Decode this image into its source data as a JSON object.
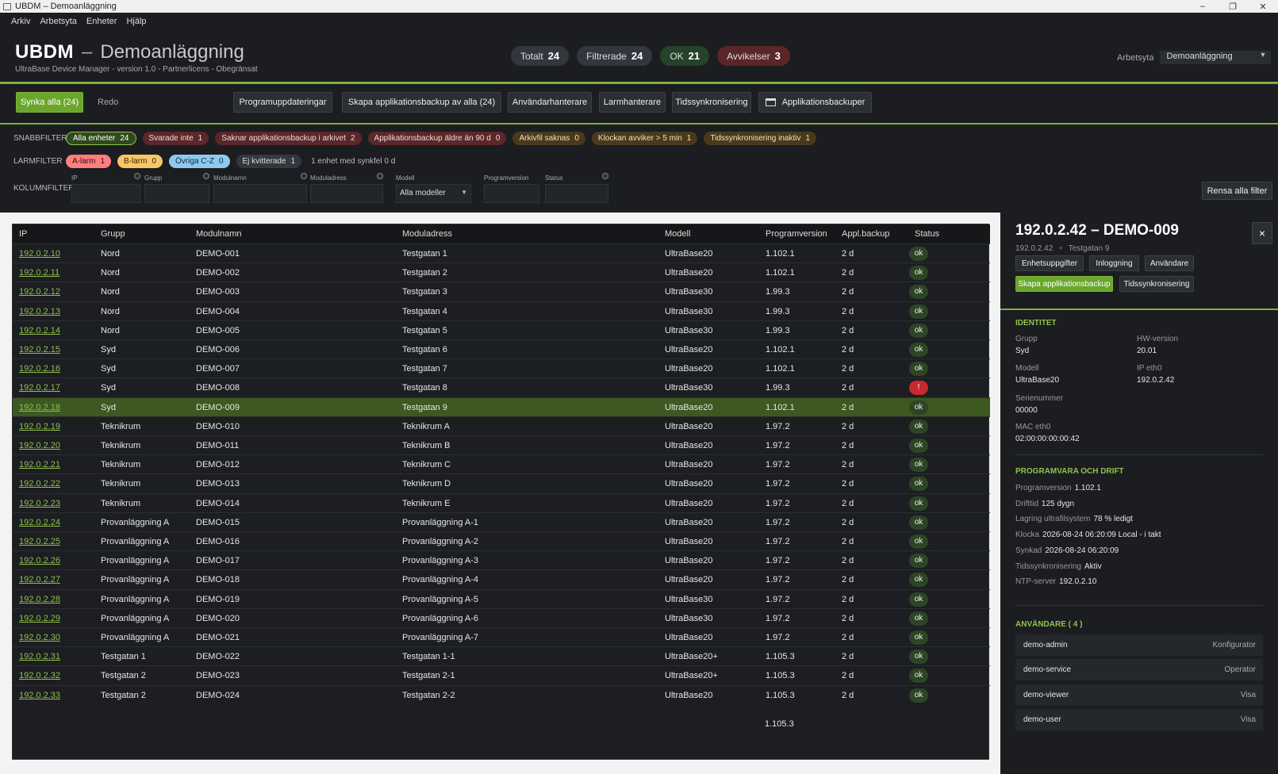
{
  "window": {
    "title": "UBDM – Demoanläggning",
    "controls": [
      "–",
      "❐",
      "✕"
    ]
  },
  "menu": [
    "Arkiv",
    "Arbetsyta",
    "Enheter",
    "Hjälp"
  ],
  "header": {
    "app": "UBDM",
    "dash": "–",
    "plant": "Demoanläggning",
    "subtitle": "UltraBase Device Manager - version 1.0 - Partnerlicens - Obegränsat",
    "counters": [
      {
        "label": "Totalt",
        "value": "24"
      },
      {
        "label": "Filtrerade",
        "value": "24"
      },
      {
        "label": "OK",
        "value": "21"
      },
      {
        "label": "Avvikelser",
        "value": "3"
      }
    ],
    "workspace_label": "Arbetsyta",
    "workspace_value": "Demoanläggning"
  },
  "toolbar": {
    "sync_all": "Synka alla (24)",
    "redo": "Redo",
    "buttons": [
      "Programuppdateringar",
      "Skapa applikationsbackup av alla (24)",
      "Användarhanterare",
      "Larmhanterare",
      "Tidssynkronisering",
      "Applikationsbackuper"
    ]
  },
  "quickfilter": {
    "label": "SNABBFILTER",
    "chips": [
      {
        "label": "Alla enheter",
        "count": "24"
      },
      {
        "label": "Svarade inte",
        "count": "1"
      },
      {
        "label": "Saknar applikationsbackup i arkivet",
        "count": "2"
      },
      {
        "label": "Applikationsbackup äldre än 90 d",
        "count": "0"
      },
      {
        "label": "Arkivfil saknas",
        "count": "0"
      },
      {
        "label": "Klockan avviker > 5 min",
        "count": "1"
      },
      {
        "label": "Tidssynkronisering inaktiv",
        "count": "1"
      }
    ]
  },
  "alarmfilter": {
    "label": "LARMFILTER",
    "chips": [
      {
        "label": "A-larm",
        "count": "1"
      },
      {
        "label": "B-larm",
        "count": "0"
      },
      {
        "label": "Övriga C-Z",
        "count": "0"
      },
      {
        "label": "Ej kvitterade",
        "count": "1"
      }
    ],
    "note": "1 enhet med synkfel 0 d"
  },
  "columnfilter": {
    "label": "KOLUMNFILTER",
    "fields": [
      "IP",
      "Grupp",
      "Modulnamn",
      "Moduladress",
      "Modell",
      "Programversion",
      "Status"
    ],
    "model_select": "Alla modeller",
    "clear": "Rensa alla filter"
  },
  "table": {
    "headers": [
      "IP",
      "Grupp",
      "Modulnamn",
      "Moduladress",
      "Modell",
      "Programversion",
      "Appl.backup",
      "Status"
    ],
    "rows": [
      [
        "192.0.2.10",
        "Nord",
        "DEMO-001",
        "Testgatan 1",
        "UltraBase20",
        "1.102.1",
        "2 d",
        "ok"
      ],
      [
        "192.0.2.11",
        "Nord",
        "DEMO-002",
        "Testgatan 2",
        "UltraBase20",
        "1.102.1",
        "2 d",
        "ok"
      ],
      [
        "192.0.2.12",
        "Nord",
        "DEMO-003",
        "Testgatan 3",
        "UltraBase30",
        "1.99.3",
        "2 d",
        "ok"
      ],
      [
        "192.0.2.13",
        "Nord",
        "DEMO-004",
        "Testgatan 4",
        "UltraBase30",
        "1.99.3",
        "2 d",
        "ok"
      ],
      [
        "192.0.2.14",
        "Nord",
        "DEMO-005",
        "Testgatan 5",
        "UltraBase30",
        "1.99.3",
        "2 d",
        "ok"
      ],
      [
        "192.0.2.15",
        "Syd",
        "DEMO-006",
        "Testgatan 6",
        "UltraBase20",
        "1.102.1",
        "2 d",
        "ok"
      ],
      [
        "192.0.2.16",
        "Syd",
        "DEMO-007",
        "Testgatan 7",
        "UltraBase20",
        "1.102.1",
        "2 d",
        "ok"
      ],
      [
        "192.0.2.17",
        "Syd",
        "DEMO-008",
        "Testgatan 8",
        "UltraBase30",
        "1.99.3",
        "2 d",
        "!"
      ],
      [
        "192.0.2.18",
        "Syd",
        "DEMO-009",
        "Testgatan 9",
        "UltraBase20",
        "1.102.1",
        "2 d",
        "ok"
      ],
      [
        "192.0.2.19",
        "Teknikrum",
        "DEMO-010",
        "Teknikrum A",
        "UltraBase20",
        "1.97.2",
        "2 d",
        "ok"
      ],
      [
        "192.0.2.20",
        "Teknikrum",
        "DEMO-011",
        "Teknikrum B",
        "UltraBase20",
        "1.97.2",
        "2 d",
        "ok"
      ],
      [
        "192.0.2.21",
        "Teknikrum",
        "DEMO-012",
        "Teknikrum C",
        "UltraBase20",
        "1.97.2",
        "2 d",
        "ok"
      ],
      [
        "192.0.2.22",
        "Teknikrum",
        "DEMO-013",
        "Teknikrum D",
        "UltraBase20",
        "1.97.2",
        "2 d",
        "ok"
      ],
      [
        "192.0.2.23",
        "Teknikrum",
        "DEMO-014",
        "Teknikrum E",
        "UltraBase20",
        "1.97.2",
        "2 d",
        "ok"
      ],
      [
        "192.0.2.24",
        "Provanläggning A",
        "DEMO-015",
        "Provanläggning A-1",
        "UltraBase20",
        "1.97.2",
        "2 d",
        "ok"
      ],
      [
        "192.0.2.25",
        "Provanläggning A",
        "DEMO-016",
        "Provanläggning A-2",
        "UltraBase20",
        "1.97.2",
        "2 d",
        "ok"
      ],
      [
        "192.0.2.26",
        "Provanläggning A",
        "DEMO-017",
        "Provanläggning A-3",
        "UltraBase20",
        "1.97.2",
        "2 d",
        "ok"
      ],
      [
        "192.0.2.27",
        "Provanläggning A",
        "DEMO-018",
        "Provanläggning A-4",
        "UltraBase20",
        "1.97.2",
        "2 d",
        "ok"
      ],
      [
        "192.0.2.28",
        "Provanläggning A",
        "DEMO-019",
        "Provanläggning A-5",
        "UltraBase30",
        "1.97.2",
        "2 d",
        "ok"
      ],
      [
        "192.0.2.29",
        "Provanläggning A",
        "DEMO-020",
        "Provanläggning A-6",
        "UltraBase30",
        "1.97.2",
        "2 d",
        "ok"
      ],
      [
        "192.0.2.30",
        "Provanläggning A",
        "DEMO-021",
        "Provanläggning A-7",
        "UltraBase20",
        "1.97.2",
        "2 d",
        "ok"
      ],
      [
        "192.0.2.31",
        "Testgatan 1",
        "DEMO-022",
        "Testgatan 1-1",
        "UltraBase20+",
        "1.105.3",
        "2 d",
        "ok"
      ],
      [
        "192.0.2.32",
        "Testgatan 2",
        "DEMO-023",
        "Testgatan 2-1",
        "UltraBase20+",
        "1.105.3",
        "2 d",
        "ok"
      ],
      [
        "192.0.2.33",
        "Testgatan 2",
        "DEMO-024",
        "Testgatan 2-2",
        "UltraBase20",
        "1.105.3",
        "2 d",
        "ok"
      ]
    ],
    "selected_index": 8,
    "extra_version": "1.105.3"
  },
  "details": {
    "title": "192.0.2.42 – DEMO-009",
    "ip": "192.0.2.42",
    "address": "Testgatan 9",
    "close": "×",
    "buttons": [
      "Enhetsuppgifter",
      "Inloggning",
      "Användare",
      "Skapa applikationsbackup",
      "Tidssynkronisering"
    ],
    "identity": {
      "heading": "IDENTITET",
      "fields": [
        {
          "label": "Grupp",
          "value": "Syd"
        },
        {
          "label": "HW-version",
          "value": "20.01"
        },
        {
          "label": "Modell",
          "value": "UltraBase20"
        },
        {
          "label": "IP eth0",
          "value": "192.0.2.42"
        },
        {
          "label": "Serienummer",
          "value": "00000"
        },
        {
          "label": "MAC eth0",
          "value": "02:00:00:00:00:42"
        }
      ]
    },
    "software": {
      "heading": "PROGRAMVARA OCH DRIFT",
      "fields": [
        {
          "label": "Programversion",
          "value": "1.102.1"
        },
        {
          "label": "Drifttid",
          "value": "125 dygn"
        },
        {
          "label": "Lagring ultrafilsystem",
          "value": "78 % ledigt"
        },
        {
          "label": "Klocka",
          "value": "2026-08-24 06:20:09 Local - i takt"
        },
        {
          "label": "Synkad",
          "value": "2026-08-24 06:20:09"
        },
        {
          "label": "Tidssynkronisering",
          "value": "Aktiv"
        },
        {
          "label": "NTP-server",
          "value": "192.0.2.10"
        }
      ]
    },
    "users": {
      "heading": "ANVÄNDARE ( 4 )",
      "list": [
        {
          "name": "demo-admin",
          "role": "Konfigurator"
        },
        {
          "name": "demo-service",
          "role": "Operator"
        },
        {
          "name": "demo-viewer",
          "role": "Visa"
        },
        {
          "name": "demo-user",
          "role": "Visa"
        }
      ]
    }
  }
}
